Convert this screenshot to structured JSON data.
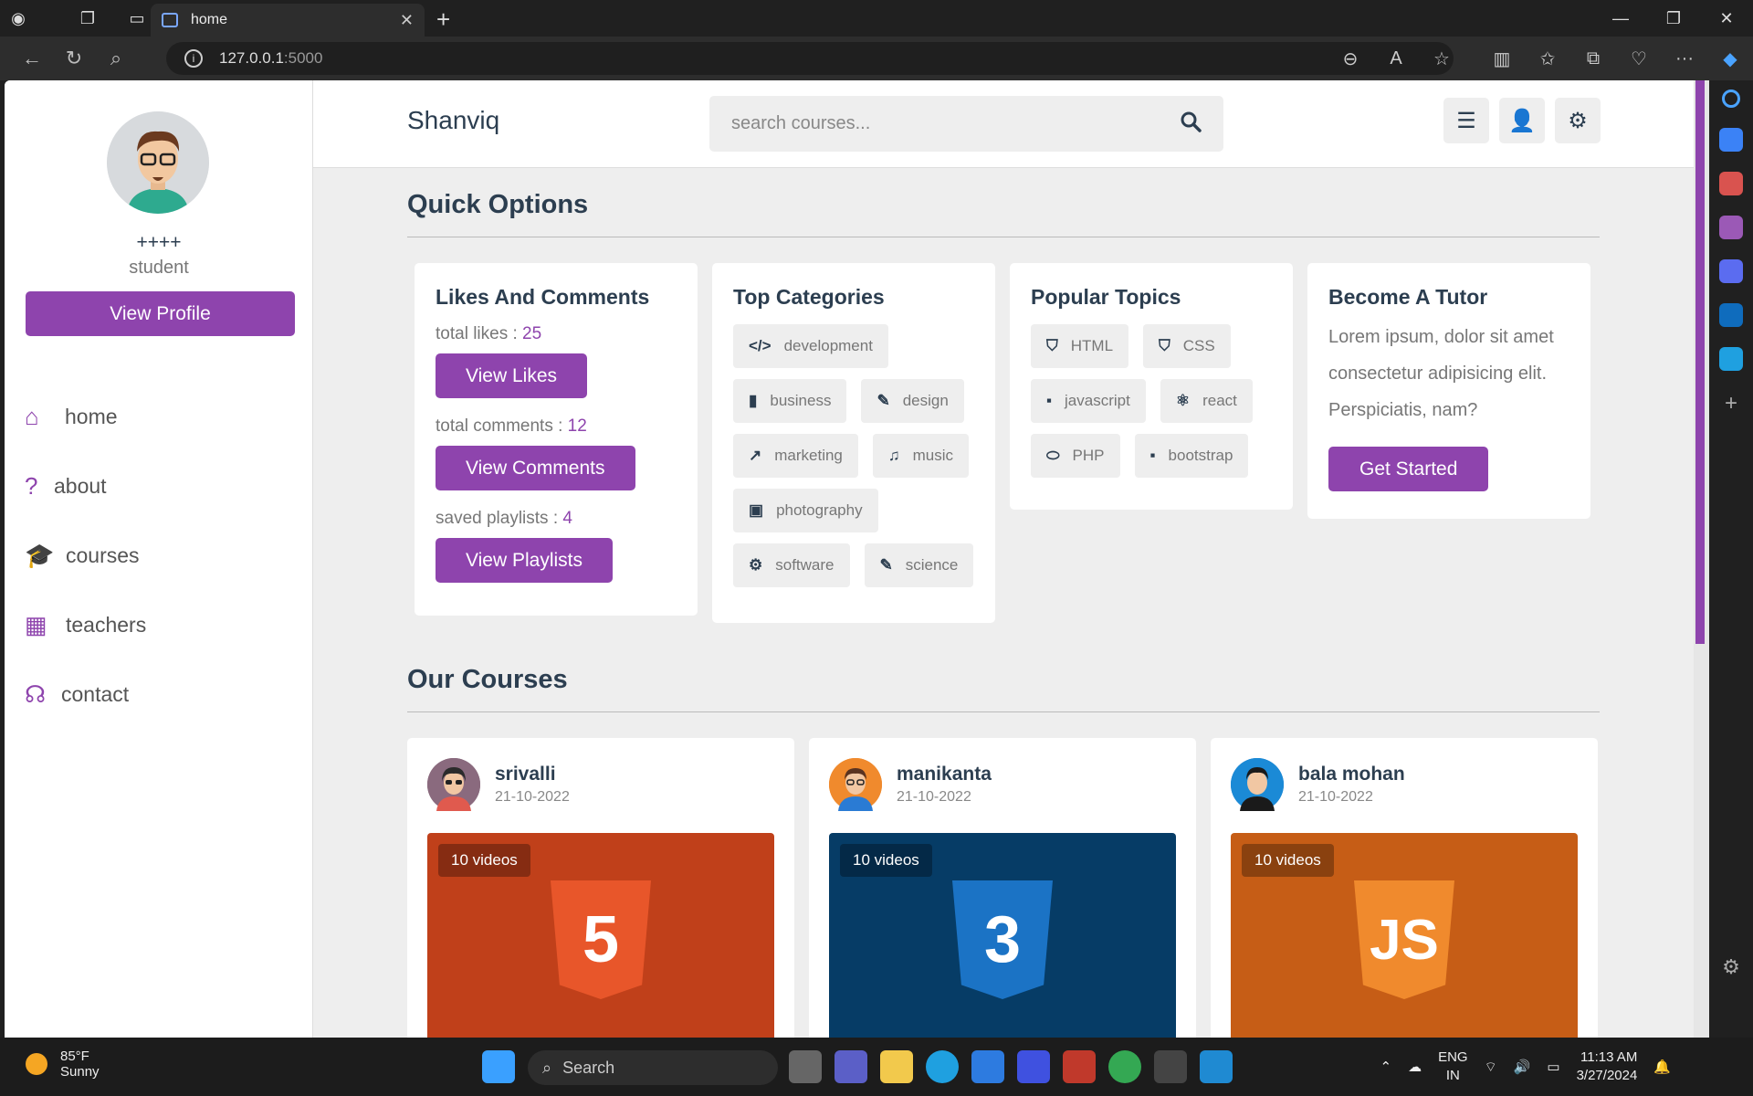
{
  "browser": {
    "tab_title": "home",
    "url_host": "127.0.0.1",
    "url_port": ":5000"
  },
  "sidebar": {
    "user_name": "++++",
    "user_role": "student",
    "view_profile": "View Profile",
    "menu": [
      {
        "label": "home",
        "icon": "home-icon"
      },
      {
        "label": "about",
        "icon": "question-icon"
      },
      {
        "label": "courses",
        "icon": "graduation-cap-icon"
      },
      {
        "label": "teachers",
        "icon": "chalkboard-teacher-icon"
      },
      {
        "label": "contact",
        "icon": "headset-icon"
      }
    ]
  },
  "header": {
    "logo": "Shanviq",
    "search_placeholder": "search courses..."
  },
  "quick_options": {
    "title": "Quick Options",
    "likes_card": {
      "title": "Likes And Comments",
      "likes_label": "total likes : ",
      "likes_value": "25",
      "view_likes": "View Likes",
      "comments_label": "total comments : ",
      "comments_value": "12",
      "view_comments": "View Comments",
      "playlists_label": "saved playlists : ",
      "playlists_value": "4",
      "view_playlists": "View Playlists"
    },
    "categories_card": {
      "title": "Top Categories",
      "tags": [
        "development",
        "business",
        "design",
        "marketing",
        "music",
        "photography",
        "software",
        "science"
      ]
    },
    "topics_card": {
      "title": "Popular Topics",
      "tags": [
        "HTML",
        "CSS",
        "javascript",
        "react",
        "PHP",
        "bootstrap"
      ]
    },
    "tutor_card": {
      "title": "Become A Tutor",
      "text": "Lorem ipsum, dolor sit amet consectetur adipisicing elit. Perspiciatis, nam?",
      "button": "Get Started"
    }
  },
  "courses": {
    "title": "Our Courses",
    "items": [
      {
        "tutor": "srivalli",
        "date": "21-10-2022",
        "videos": "10 videos",
        "logo": "5",
        "bg": "#c0401a",
        "shield": "#e8562a"
      },
      {
        "tutor": "manikanta",
        "date": "21-10-2022",
        "videos": "10 videos",
        "logo": "3",
        "bg": "#063c66",
        "shield": "#1b73c5"
      },
      {
        "tutor": "bala mohan",
        "date": "21-10-2022",
        "videos": "10 videos",
        "logo": "JS",
        "bg": "#c65d16",
        "shield": "#f08a2d"
      }
    ]
  },
  "taskbar": {
    "temperature": "85°F",
    "weather": "Sunny",
    "search": "Search",
    "lang1": "ENG",
    "lang2": "IN",
    "time": "11:13 AM",
    "date": "3/27/2024"
  },
  "colors": {
    "accent": "#8e44ad",
    "text": "#2c3e50"
  }
}
